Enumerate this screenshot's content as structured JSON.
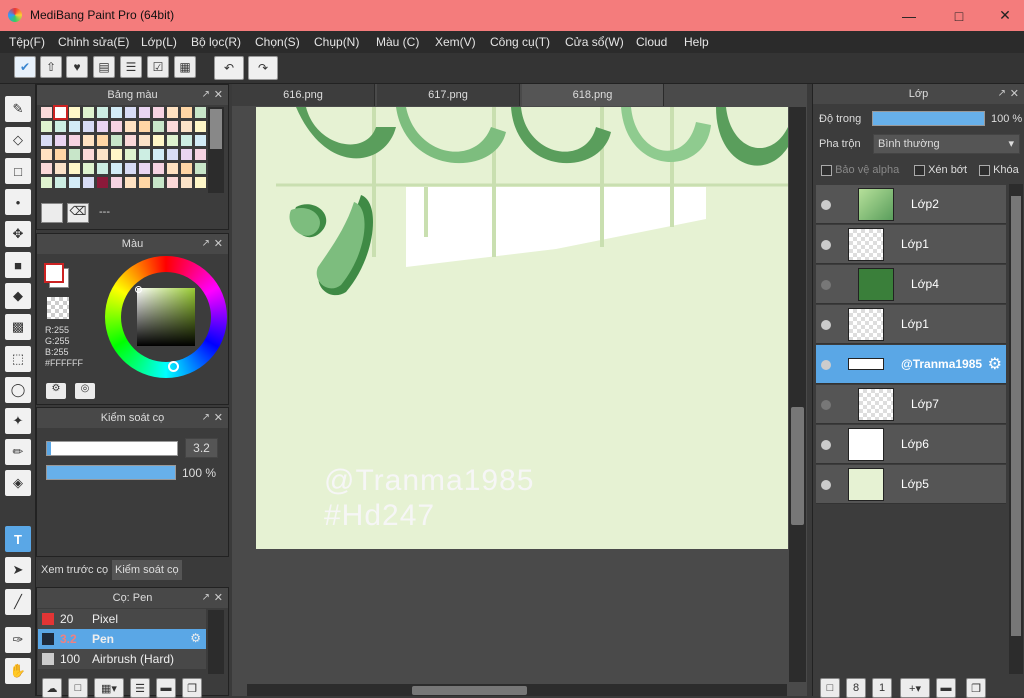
{
  "window": {
    "title": "MediBang Paint Pro (64bit)"
  },
  "menu": [
    "Tệp(F)",
    "Chỉnh sửa(E)",
    "Lớp(L)",
    "Bộ lọc(R)",
    "Chọn(S)",
    "Chụp(N)",
    "Màu (C)",
    "Xem(V)",
    "Công cụ(T)",
    "Cửa sổ(W)",
    "Cloud",
    "Help"
  ],
  "tabs": [
    "616.png",
    "617.png",
    "618.png"
  ],
  "palette": {
    "title": "Bảng màu",
    "label": "---"
  },
  "color": {
    "title": "Màu",
    "r": "R:255",
    "g": "G:255",
    "b": "B:255",
    "hex": "#FFFFFF"
  },
  "brush_control": {
    "title": "Kiểm soát cọ",
    "size": "3.2",
    "opacity": "100 %"
  },
  "left_tabs": [
    "Xem trước cọ",
    "Kiểm soát cọ"
  ],
  "brush_panel": {
    "title": "Cọ: Pen",
    "items": [
      {
        "num": "20",
        "name": "Pixel",
        "color": "#e33535"
      },
      {
        "num": "3.2",
        "name": "Pen",
        "color": "#1e2a3a"
      },
      {
        "num": "100",
        "name": "Airbrush (Hard)",
        "color": "#cccccc"
      }
    ]
  },
  "canvas_text": {
    "line1": "@Tranma1985",
    "line2": "#Hd247"
  },
  "layers_panel": {
    "title": "Lớp",
    "opacity_label": "Độ trong",
    "opacity_value": "100 %",
    "blend_label": "Pha trộn",
    "blend_value": "Bình thường",
    "protect_alpha": "Bảo vệ alpha",
    "clip": "Xén bớt",
    "lock": "Khóa",
    "layers": [
      {
        "name": "Lớp2"
      },
      {
        "name": "Lớp1"
      },
      {
        "name": "Lớp4"
      },
      {
        "name": "Lớp1"
      },
      {
        "name": "@Tranma1985"
      },
      {
        "name": "Lớp7"
      },
      {
        "name": "Lớp6"
      },
      {
        "name": "Lớp5"
      }
    ]
  },
  "colors": {
    "accent": "#5aa7e6",
    "titlebar": "#f47c7c",
    "canvas_bg": "#e6f2d3",
    "leaf": "#5a9e5c"
  }
}
